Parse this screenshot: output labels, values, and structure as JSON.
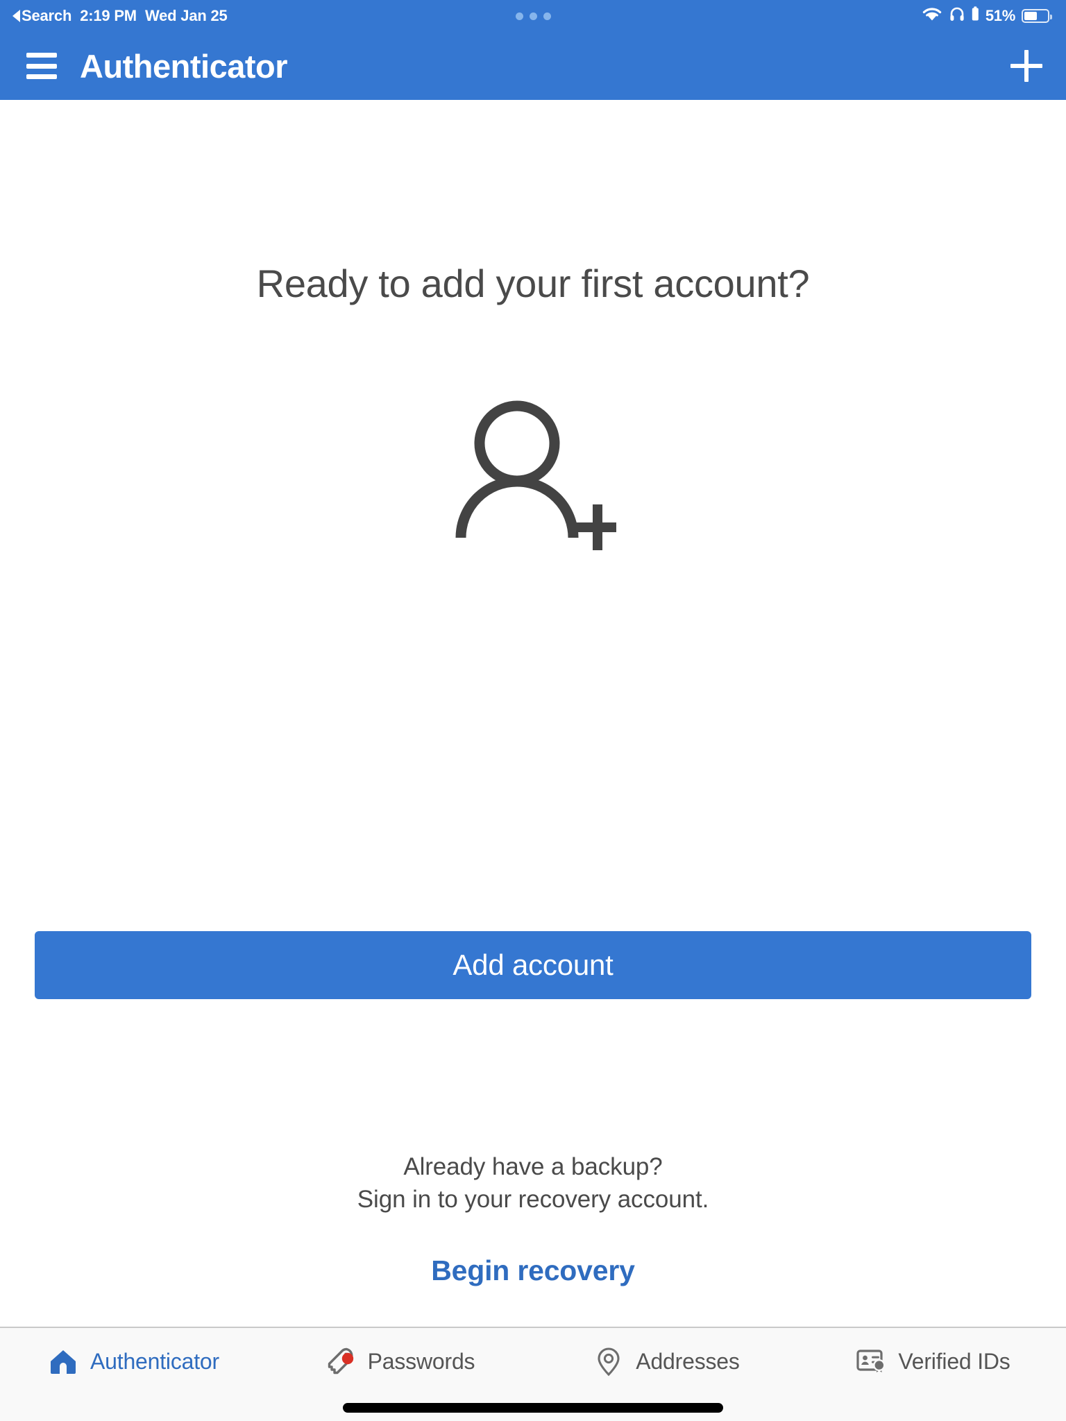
{
  "status_bar": {
    "back_label": "Search",
    "time": "2:19 PM",
    "date": "Wed Jan 25",
    "battery_percent": "51%",
    "battery_level": 51,
    "icons": {
      "back": "back-triangle-icon",
      "wifi": "wifi-icon",
      "headphones": "headphones-icon",
      "headphones_battery": "headphones-battery-icon",
      "battery": "battery-icon",
      "activity": "three-dots-activity-icon"
    },
    "accent_color": "#86b5ec"
  },
  "header": {
    "title": "Authenticator",
    "menu_icon": "hamburger-menu-icon",
    "add_icon": "plus-icon",
    "background_color": "#3577d1",
    "text_color": "#ffffff"
  },
  "main": {
    "headline": "Ready to add your first account?",
    "hero_icon": "person-add-icon",
    "hero_icon_color": "#434343",
    "primary_button": {
      "label": "Add account",
      "color": "#3577d1"
    },
    "recovery": {
      "line1": "Already have a backup?",
      "line2": "Sign in to your recovery account.",
      "link_label": "Begin recovery",
      "link_color": "#2f6cbf"
    }
  },
  "tab_bar": {
    "active_color": "#2f6cbf",
    "inactive_color": "#555555",
    "badge_color": "#d93025",
    "background_color": "#f9f9f9",
    "tabs": [
      {
        "label": "Authenticator",
        "icon": "home-icon",
        "active": true,
        "badge": false
      },
      {
        "label": "Passwords",
        "icon": "key-icon",
        "active": false,
        "badge": true
      },
      {
        "label": "Addresses",
        "icon": "location-pin-icon",
        "active": false,
        "badge": false
      },
      {
        "label": "Verified IDs",
        "icon": "id-card-badge-icon",
        "active": false,
        "badge": false
      }
    ]
  },
  "home_indicator": {
    "name": "home-indicator"
  }
}
